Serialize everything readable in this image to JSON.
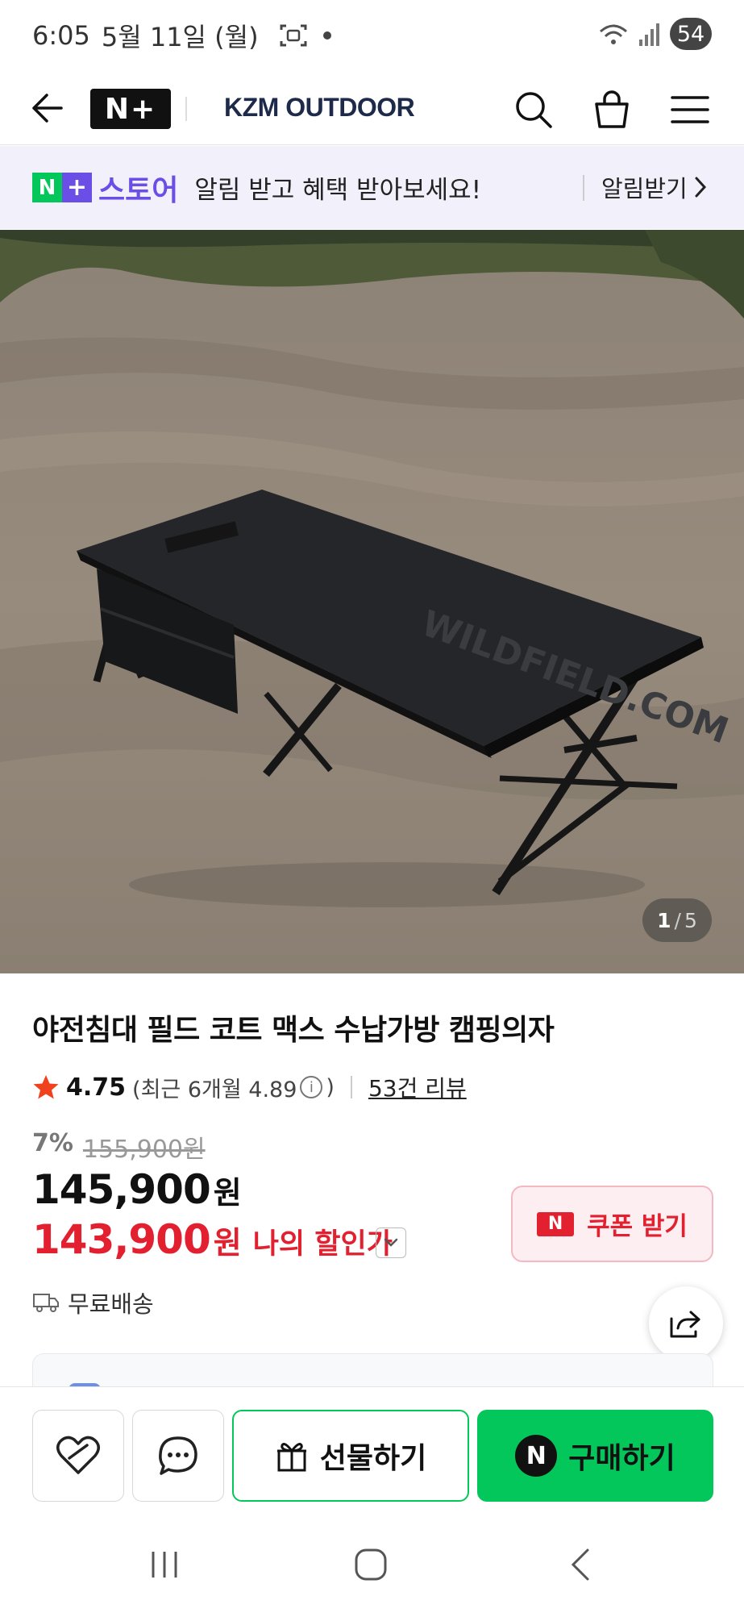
{
  "status_bar": {
    "time": "6:05",
    "date": "5월 11일 (월)",
    "battery": "54"
  },
  "header": {
    "logo_text": "N+",
    "brand": "KZM OUTDOOR"
  },
  "banner": {
    "store_n": "N",
    "store_plus": "+",
    "store_label": "스토어",
    "message": "알림 받고 혜택 받아보세요!",
    "cta": "알림받기"
  },
  "gallery": {
    "current": "1",
    "separator": "/",
    "total": "5"
  },
  "product": {
    "title": "야전침대 필드 코트 맥스 수납가방 캠핑의자",
    "rating": "4.75",
    "recent_rating_open": "(최근 6개월 4.89",
    "recent_rating_close": ")",
    "review_link": "53건 리뷰",
    "discount_rate": "7%",
    "original_price": "155,900원",
    "price": "145,900",
    "price_unit": "원",
    "my_price": "143,900",
    "my_price_unit": "원",
    "my_price_label": "나의 할인가",
    "coupon_label": "쿠폰 받기",
    "coupon_badge": "N",
    "shipping": "무료배송"
  },
  "bottom_bar": {
    "gift_label": "선물하기",
    "buy_badge": "N",
    "buy_label": "구매하기"
  },
  "colors": {
    "naver_green": "#03c75a",
    "store_purple": "#6b4ee6",
    "price_red": "#e2202f",
    "brand_navy": "#1e2a4a"
  }
}
